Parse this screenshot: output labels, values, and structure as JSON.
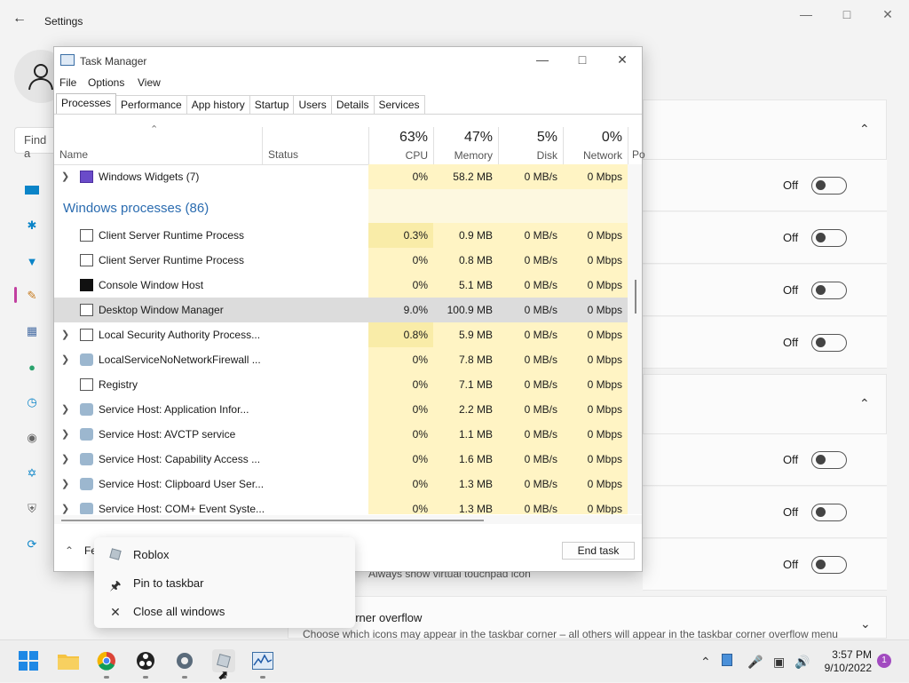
{
  "settings": {
    "title": "Settings",
    "search_placeholder": "Find a",
    "rows_off": [
      "Off",
      "Off",
      "Off",
      "Off",
      "Off",
      "Off",
      "Off"
    ],
    "touchpad_text": "Always show virtual touchpad icon",
    "overflow_title": "orner overflow",
    "overflow_desc": "Choose which icons may appear in the taskbar corner – all others will appear in the taskbar corner overflow menu"
  },
  "taskmanager": {
    "title": "Task Manager",
    "menu": [
      "File",
      "Options",
      "View"
    ],
    "tabs": [
      "Processes",
      "Performance",
      "App history",
      "Startup",
      "Users",
      "Details",
      "Services"
    ],
    "headers": {
      "name": "Name",
      "status": "Status",
      "cpu_pct": "63%",
      "cpu": "CPU",
      "mem_pct": "47%",
      "mem": "Memory",
      "disk_pct": "5%",
      "disk": "Disk",
      "net_pct": "0%",
      "net": "Network",
      "power": "Po"
    },
    "group_label": "Windows processes (86)",
    "processes": [
      {
        "name": "Windows Widgets (7)",
        "cpu": "0%",
        "mem": "58.2 MB",
        "disk": "0 MB/s",
        "net": "0 Mbps"
      },
      {
        "name": "Client Server Runtime Process",
        "cpu": "0.3%",
        "mem": "0.9 MB",
        "disk": "0 MB/s",
        "net": "0 Mbps"
      },
      {
        "name": "Client Server Runtime Process",
        "cpu": "0%",
        "mem": "0.8 MB",
        "disk": "0 MB/s",
        "net": "0 Mbps"
      },
      {
        "name": "Console Window Host",
        "cpu": "0%",
        "mem": "5.1 MB",
        "disk": "0 MB/s",
        "net": "0 Mbps"
      },
      {
        "name": "Desktop Window Manager",
        "cpu": "9.0%",
        "mem": "100.9 MB",
        "disk": "0 MB/s",
        "net": "0 Mbps"
      },
      {
        "name": "Local Security Authority Process...",
        "cpu": "0.8%",
        "mem": "5.9 MB",
        "disk": "0 MB/s",
        "net": "0 Mbps"
      },
      {
        "name": "LocalServiceNoNetworkFirewall ...",
        "cpu": "0%",
        "mem": "7.8 MB",
        "disk": "0 MB/s",
        "net": "0 Mbps"
      },
      {
        "name": "Registry",
        "cpu": "0%",
        "mem": "7.1 MB",
        "disk": "0 MB/s",
        "net": "0 Mbps"
      },
      {
        "name": "Service Host: Application Infor...",
        "cpu": "0%",
        "mem": "2.2 MB",
        "disk": "0 MB/s",
        "net": "0 Mbps"
      },
      {
        "name": "Service Host: AVCTP service",
        "cpu": "0%",
        "mem": "1.1 MB",
        "disk": "0 MB/s",
        "net": "0 Mbps"
      },
      {
        "name": "Service Host: Capability Access ...",
        "cpu": "0%",
        "mem": "1.6 MB",
        "disk": "0 MB/s",
        "net": "0 Mbps"
      },
      {
        "name": "Service Host: Clipboard User Ser...",
        "cpu": "0%",
        "mem": "1.3 MB",
        "disk": "0 MB/s",
        "net": "0 Mbps"
      },
      {
        "name": "Service Host: COM+ Event Syste...",
        "cpu": "0%",
        "mem": "1.3 MB",
        "disk": "0 MB/s",
        "net": "0 Mbps"
      }
    ],
    "fewer_details": "Fe",
    "end_task": "End task"
  },
  "context_menu": {
    "items": [
      "Roblox",
      "Pin to taskbar",
      "Close all windows"
    ]
  },
  "taskbar": {
    "time": "3:57 PM",
    "date": "9/10/2022",
    "notification_count": "1"
  },
  "colors": {
    "accent": "#2b6cb0",
    "highlight": "#fff4c4",
    "selected": "#dcdcdc"
  }
}
